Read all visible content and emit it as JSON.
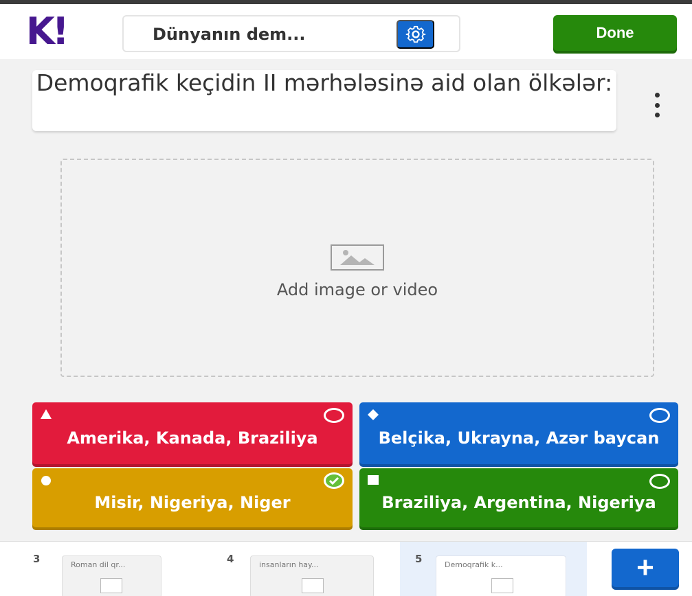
{
  "app": {
    "logo": "K!",
    "quiz_title": "Dünyanın dem...",
    "done_label": "Done"
  },
  "question": {
    "text": "Demoqrafik keçidin II mərhələsinə aid olan ölkələr:"
  },
  "media": {
    "label": "Add image or video"
  },
  "answers": [
    {
      "text": "Amerika, Kanada, Braziliya",
      "shape": "triangle",
      "color": "#e21b3c",
      "correct": false
    },
    {
      "text": "Belçika, Ukrayna, Azər baycan",
      "shape": "diamond",
      "color": "#1368ce",
      "correct": false
    },
    {
      "text": "Misir, Nigeriya, Niger",
      "shape": "circle",
      "color": "#d89e00",
      "correct": true
    },
    {
      "text": "Braziliya, Argentina, Nigeriya",
      "shape": "square",
      "color": "#26890c",
      "correct": false
    }
  ],
  "slides": [
    {
      "number": "3",
      "title": "Roman dil qr..."
    },
    {
      "number": "4",
      "title": "insanların hay..."
    },
    {
      "number": "5",
      "title": "Demoqrafik k..."
    }
  ],
  "add_label": "+"
}
